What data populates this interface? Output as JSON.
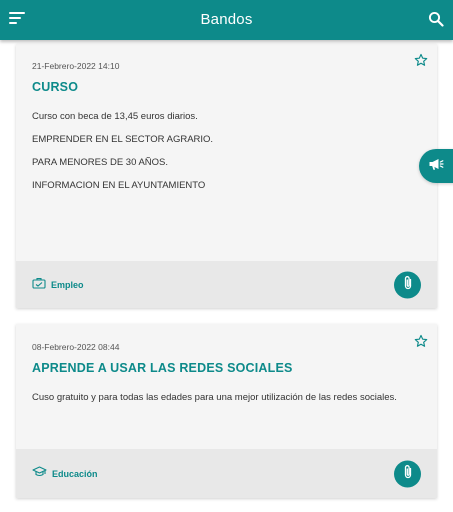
{
  "app": {
    "title": "Bandos"
  },
  "colors": {
    "primary": "#0d8a8a",
    "card_bg": "#f5f5f5",
    "footer_bg": "#e8e8e8"
  },
  "posts": [
    {
      "date": "21-Febrero-2022 14:10",
      "title": "CURSO",
      "body": [
        "Curso con beca de 13,45 euros diarios.",
        "EMPRENDER EN EL SECTOR AGRARIO.",
        "PARA MENORES DE 30 AÑOS.",
        "INFORMACION EN EL AYUNTAMIENTO"
      ],
      "category": {
        "label": "Empleo",
        "icon": "briefcase-icon"
      },
      "attachment_icon": "paperclip-icon",
      "favorite_icon": "star-outline-icon"
    },
    {
      "date": "08-Febrero-2022 08:44",
      "title": "APRENDE A USAR LAS REDES SOCIALES",
      "body": [
        "Cuso gratuito y para todas las edades para una mejor utilización de las redes sociales."
      ],
      "category": {
        "label": "Educación",
        "icon": "graduation-cap-icon"
      },
      "attachment_icon": "paperclip-icon",
      "favorite_icon": "star-outline-icon"
    }
  ],
  "side_tab": {
    "icon": "megaphone-icon"
  }
}
